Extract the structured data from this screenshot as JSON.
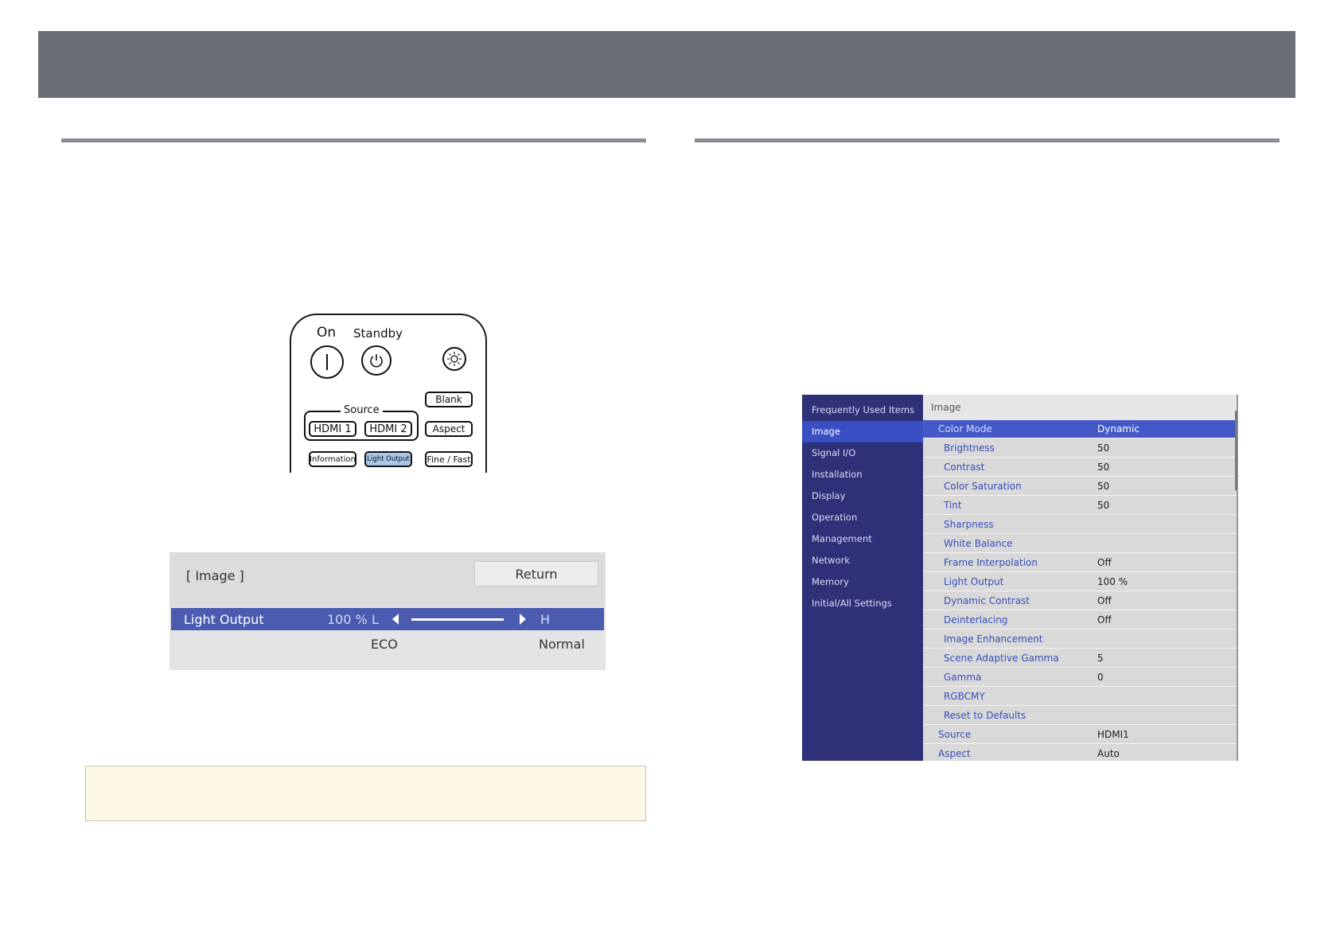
{
  "remote": {
    "on_label": "On",
    "standby_label": "Standby",
    "blank": "Blank",
    "source_label": "Source",
    "hdmi1": "HDMI 1",
    "hdmi2": "HDMI 2",
    "aspect": "Aspect",
    "information": "Information",
    "light_output": "Light Output",
    "fine_fast": "Fine / Fast"
  },
  "light_output_menu": {
    "title": "[ Image ]",
    "return_label": "Return",
    "item_label": "Light Output",
    "value": "100 %",
    "low_label": "L",
    "high_label": "H",
    "eco_label": "ECO",
    "normal_label": "Normal",
    "level_fraction": 1.0
  },
  "projector_menu": {
    "sidebar": [
      {
        "label": "Frequently Used Items"
      },
      {
        "label": "Image",
        "selected": true
      },
      {
        "label": "Signal I/O"
      },
      {
        "label": "Installation"
      },
      {
        "label": "Display"
      },
      {
        "label": "Operation"
      },
      {
        "label": "Management"
      },
      {
        "label": "Network"
      },
      {
        "label": "Memory"
      },
      {
        "label": "Initial/All Settings"
      }
    ],
    "header": "Image",
    "rows": [
      {
        "label": "Color Mode",
        "value": "Dynamic",
        "selected": true,
        "top": true
      },
      {
        "label": "Brightness",
        "value": "50"
      },
      {
        "label": "Contrast",
        "value": "50"
      },
      {
        "label": "Color Saturation",
        "value": "50"
      },
      {
        "label": "Tint",
        "value": "50"
      },
      {
        "label": "Sharpness",
        "value": ""
      },
      {
        "label": "White Balance",
        "value": ""
      },
      {
        "label": "Frame Interpolation",
        "value": "Off"
      },
      {
        "label": "Light Output",
        "value": "100 %"
      },
      {
        "label": "Dynamic Contrast",
        "value": "Off"
      },
      {
        "label": "Deinterlacing",
        "value": "Off"
      },
      {
        "label": "Image Enhancement",
        "value": ""
      },
      {
        "label": "Scene Adaptive Gamma",
        "value": "5"
      },
      {
        "label": "Gamma",
        "value": "0"
      },
      {
        "label": "RGBCMY",
        "value": ""
      },
      {
        "label": "Reset to Defaults",
        "value": ""
      },
      {
        "label": "Source",
        "value": "HDMI1",
        "top": true
      },
      {
        "label": "Aspect",
        "value": "Auto",
        "top": true
      }
    ]
  },
  "colors": {
    "header_bar": "#6b6e76",
    "menu_sidebar": "#2e3178",
    "menu_selected": "#4458c8",
    "menu_text": "#3a4fb8",
    "slider_row": "#4a5bb0",
    "note_bg": "#fcf7e6"
  }
}
